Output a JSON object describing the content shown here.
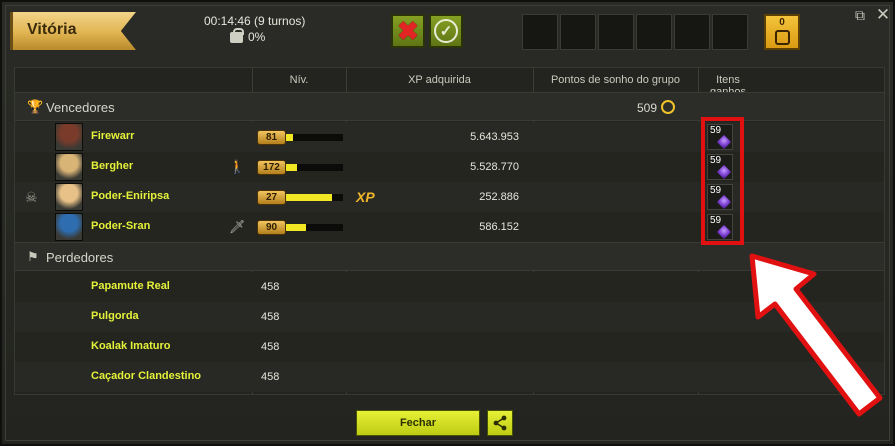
{
  "header": {
    "title": "Vitória",
    "duration": "00:14:46 (9 turnos)",
    "percent": "0%",
    "reject_icon": "x-icon",
    "accept_icon": "check-circle-icon",
    "team_count": "0"
  },
  "table": {
    "columns": [
      "Nív.",
      "XP adquirida",
      "Pontos de sonho do grupo",
      "Itens ganhos"
    ],
    "winners_label": "Vencedores",
    "losers_label": "Perdedores",
    "group_dream_points": "509",
    "winners": [
      {
        "name": "Firewarr",
        "level": "81",
        "level_progress": 0.12,
        "xp": "5.643.953",
        "item_qty": "59",
        "role_icon": "",
        "avatar_color": "#7a3b2b"
      },
      {
        "name": "Bergher",
        "level": "172",
        "level_progress": 0.2,
        "xp": "5.528.770",
        "item_qty": "59",
        "role_icon": "person-icon",
        "avatar_color": "#d9b477"
      },
      {
        "name": "Poder-Eniripsa",
        "level": "27",
        "level_progress": 0.8,
        "xp": "252.886",
        "xp_tag": "XP",
        "item_qty": "59",
        "role_icon": "",
        "avatar_color": "#e7c187"
      },
      {
        "name": "Poder-Sran",
        "level": "90",
        "level_progress": 0.35,
        "xp": "586.152",
        "item_qty": "59",
        "role_icon": "sword-icon",
        "avatar_color": "#2e6db0"
      }
    ],
    "losers": [
      {
        "name": "Papamute Real",
        "level": "458"
      },
      {
        "name": "Pulgorda",
        "level": "458"
      },
      {
        "name": "Koalak Imaturo",
        "level": "458"
      },
      {
        "name": "Caçador Clandestino",
        "level": "458"
      }
    ]
  },
  "footer": {
    "close_label": "Fechar",
    "share_icon": "share-icon"
  },
  "colors": {
    "accent_yellow": "#e4f23a",
    "annotation_red": "#e11111"
  }
}
